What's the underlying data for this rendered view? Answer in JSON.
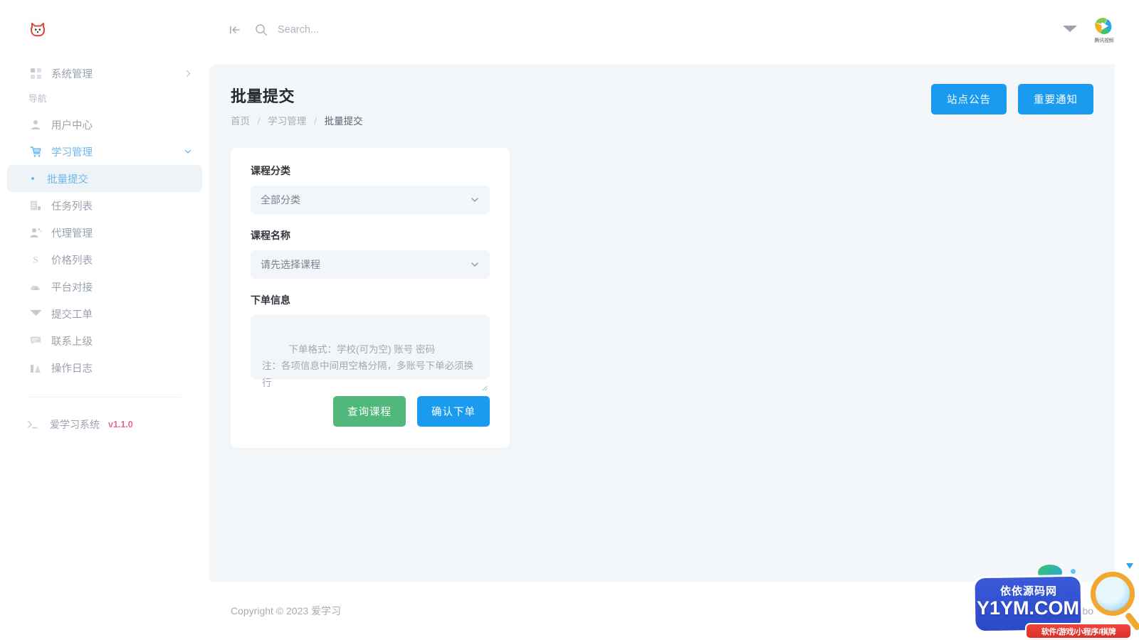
{
  "sidebar": {
    "logo_icon": "cat-logo-icon",
    "top_item": {
      "label": "系统管理",
      "icon": "grid-icon",
      "chevron": "chevron-right-icon"
    },
    "section_label": "导航",
    "items": [
      {
        "label": "用户中心",
        "icon": "user-icon",
        "active": false
      },
      {
        "label": "学习管理",
        "icon": "cart-icon",
        "active": true,
        "chevron": "chevron-down-icon"
      },
      {
        "label": "任务列表",
        "icon": "task-list-icon",
        "active": false
      },
      {
        "label": "代理管理",
        "icon": "agents-icon",
        "active": false
      },
      {
        "label": "价格列表",
        "icon": "price-s-icon",
        "active": false
      },
      {
        "label": "平台对接",
        "icon": "cloud-icon",
        "active": false
      },
      {
        "label": "提交工单",
        "icon": "envelope-icon",
        "active": false
      },
      {
        "label": "联系上级",
        "icon": "message-icon",
        "active": false
      },
      {
        "label": "操作日志",
        "icon": "chart-bars-icon",
        "active": false
      }
    ],
    "sub_item": {
      "label": "批量提交",
      "active": true
    },
    "footer": {
      "icon": "terminal-icon",
      "label": "爱学习系统",
      "version": "v1.1.0",
      "version_color": "#e86a8c"
    }
  },
  "topbar": {
    "collapse_icon": "collapse-left-icon",
    "search_icon": "search-icon",
    "search_placeholder": "Search...",
    "mail_icon": "envelope-icon",
    "brand": {
      "icon": "tencent-video-icon",
      "caption": "腾讯视频"
    }
  },
  "page": {
    "title": "批量提交",
    "breadcrumb": [
      "首页",
      "学习管理",
      "批量提交"
    ],
    "actions": [
      {
        "label": "站点公告",
        "color": "#1a9bf0"
      },
      {
        "label": "重要通知",
        "color": "#1a9bf0"
      }
    ]
  },
  "form": {
    "category_label": "课程分类",
    "category_value": "全部分类",
    "course_label": "课程名称",
    "course_value": "请先选择课程",
    "order_label": "下单信息",
    "order_placeholder": "下单格式：学校(可为空) 账号 密码\n注：各项信息中间用空格分隔，多账号下单必须换行",
    "query_button": "查询课程",
    "submit_button": "确认下单",
    "query_color": "#4fb87a",
    "submit_color": "#1a9bf0",
    "chevron_icon": "chevron-down-icon"
  },
  "footer": {
    "copyright": "Copyright © 2023 爱学习",
    "right_text": "Abo"
  },
  "watermark": {
    "line1": "依依源码网",
    "line2": "Y1YM.COM",
    "line3": "软件/游戏/小程序/棋牌"
  }
}
